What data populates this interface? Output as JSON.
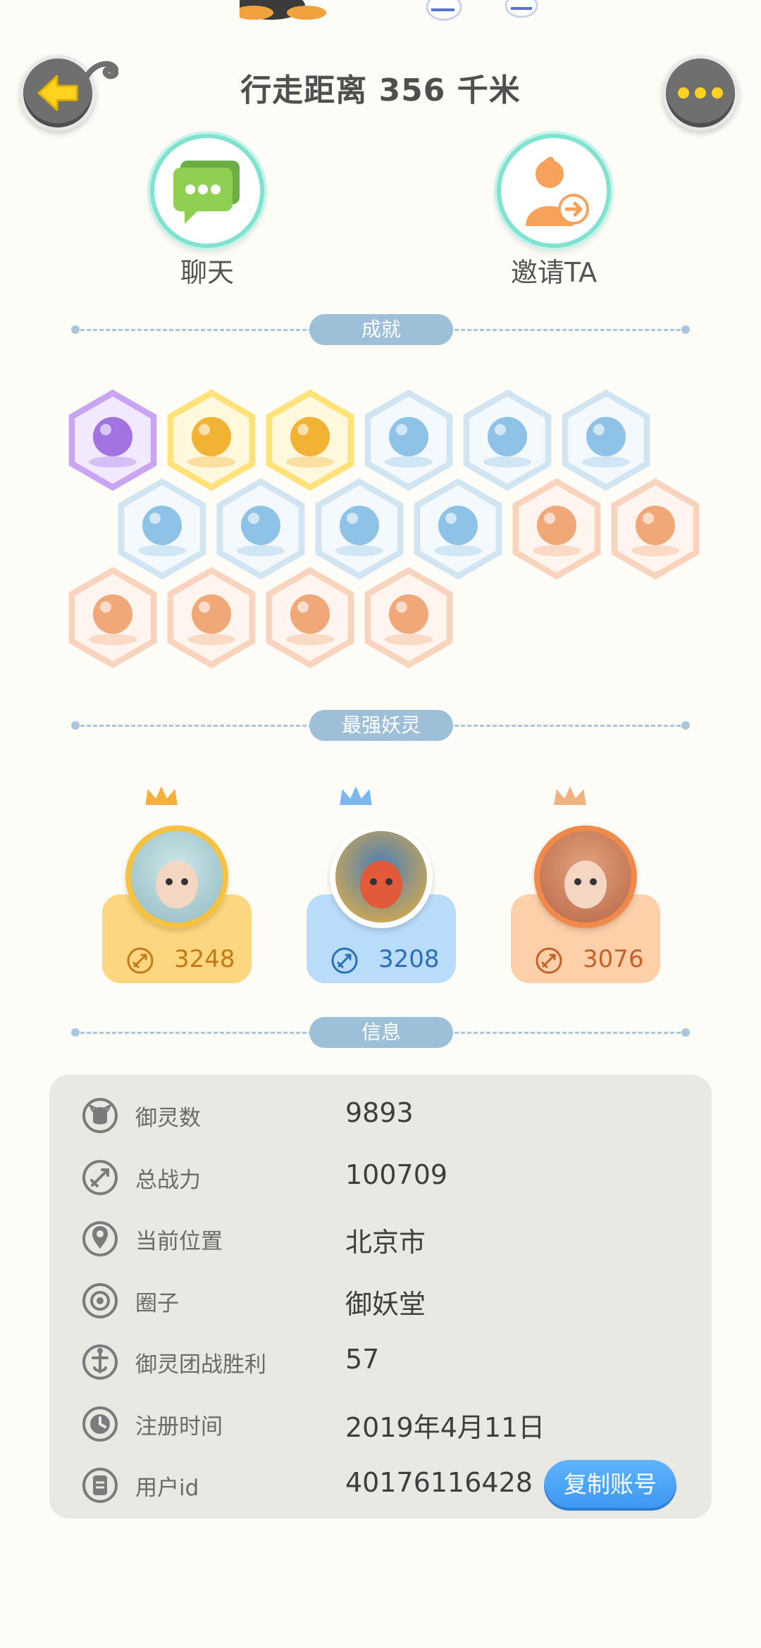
{
  "header": {
    "title": "行走距离 356 千米",
    "back_icon": "arrow-left-icon",
    "more_icon": "more-dots-icon"
  },
  "actions": {
    "chat_label": "聊天",
    "invite_label": "邀请TA"
  },
  "sections": {
    "achievements": "成就",
    "top_spirits": "最强妖灵",
    "info": "信息"
  },
  "achievements": [
    {
      "icon": "yin-yang-flame-badge-icon",
      "tier": "purple"
    },
    {
      "icon": "fox-face-badge-icon",
      "tier": "gold"
    },
    {
      "icon": "gold-orb-badge-icon",
      "tier": "gold"
    },
    {
      "icon": "sneaker-badge-icon",
      "tier": "blue"
    },
    {
      "icon": "target-badge-icon",
      "tier": "blue"
    },
    {
      "icon": "crystal-badge-icon",
      "tier": "blue"
    },
    {
      "icon": "spirit-figure-badge-icon",
      "tier": "blue"
    },
    {
      "icon": "cat-spirit-badge-icon",
      "tier": "blue"
    },
    {
      "icon": "yin-yang-book-badge-icon",
      "tier": "blue"
    },
    {
      "icon": "creature-badge-icon",
      "tier": "blue"
    },
    {
      "icon": "moon-badge-icon",
      "tier": "peach"
    },
    {
      "icon": "cat-cart-badge-icon",
      "tier": "peach"
    },
    {
      "icon": "koi-badge-icon",
      "tier": "peach"
    },
    {
      "icon": "shield-badge-icon",
      "tier": "peach"
    },
    {
      "icon": "ox-badge-icon",
      "tier": "peach"
    },
    {
      "icon": "fox-book-badge-icon",
      "tier": "peach"
    }
  ],
  "top_spirits": [
    {
      "score": "3248",
      "crown": "gold-crown-icon",
      "card_color": "#fcd77f",
      "text_color": "#c7781a"
    },
    {
      "score": "3208",
      "crown": "blue-crown-icon",
      "card_color": "#b9dcfb",
      "text_color": "#2a6fb3"
    },
    {
      "score": "3076",
      "crown": "bronze-crown-icon",
      "card_color": "#fdd0a9",
      "text_color": "#c4602a"
    }
  ],
  "info": {
    "rows": [
      {
        "icon": "spirit-count-icon",
        "label": "御灵数",
        "value": "9893"
      },
      {
        "icon": "sword-power-icon",
        "label": "总战力",
        "value": "100709"
      },
      {
        "icon": "location-pin-icon",
        "label": "当前位置",
        "value": "北京市"
      },
      {
        "icon": "circle-group-icon",
        "label": "圈子",
        "value": "御妖堂"
      },
      {
        "icon": "team-battle-icon",
        "label": "御灵团战胜利",
        "value": "57"
      },
      {
        "icon": "clock-icon",
        "label": "注册时间",
        "value": "2019年4月11日"
      },
      {
        "icon": "user-id-icon",
        "label": "用户id",
        "value": "40176116428"
      }
    ],
    "copy_button": "复制账号"
  }
}
